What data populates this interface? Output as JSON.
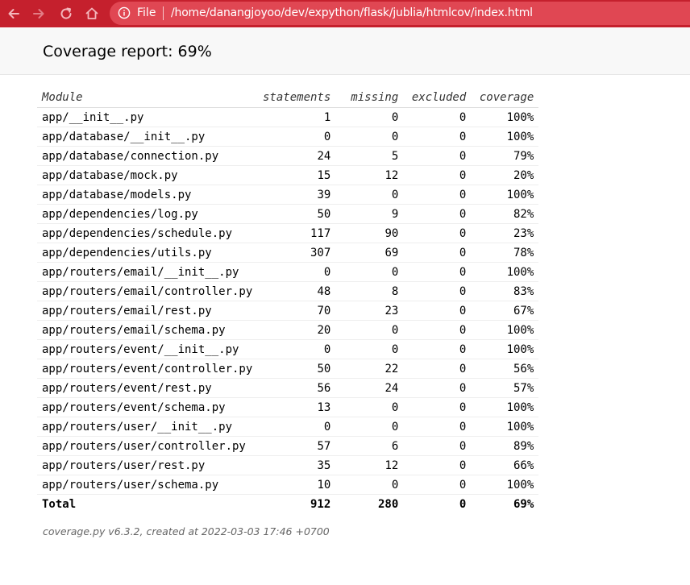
{
  "browser": {
    "scheme_label": "File",
    "url": "/home/danangjoyoo/dev/expython/flask/jublia/htmlcov/index.html",
    "colors": {
      "toolbar": "#c5202d",
      "urlbar": "#e04753"
    },
    "icons": [
      "back-arrow-icon",
      "forward-arrow-icon",
      "reload-icon",
      "home-icon",
      "info-icon"
    ]
  },
  "header": {
    "title": "Coverage report: 69%"
  },
  "table": {
    "columns": {
      "module": "Module",
      "statements": "statements",
      "missing": "missing",
      "excluded": "excluded",
      "coverage": "coverage"
    },
    "rows": [
      {
        "module": "app/__init__.py",
        "statements": "1",
        "missing": "0",
        "excluded": "0",
        "coverage": "100%"
      },
      {
        "module": "app/database/__init__.py",
        "statements": "0",
        "missing": "0",
        "excluded": "0",
        "coverage": "100%"
      },
      {
        "module": "app/database/connection.py",
        "statements": "24",
        "missing": "5",
        "excluded": "0",
        "coverage": "79%"
      },
      {
        "module": "app/database/mock.py",
        "statements": "15",
        "missing": "12",
        "excluded": "0",
        "coverage": "20%"
      },
      {
        "module": "app/database/models.py",
        "statements": "39",
        "missing": "0",
        "excluded": "0",
        "coverage": "100%"
      },
      {
        "module": "app/dependencies/log.py",
        "statements": "50",
        "missing": "9",
        "excluded": "0",
        "coverage": "82%"
      },
      {
        "module": "app/dependencies/schedule.py",
        "statements": "117",
        "missing": "90",
        "excluded": "0",
        "coverage": "23%"
      },
      {
        "module": "app/dependencies/utils.py",
        "statements": "307",
        "missing": "69",
        "excluded": "0",
        "coverage": "78%"
      },
      {
        "module": "app/routers/email/__init__.py",
        "statements": "0",
        "missing": "0",
        "excluded": "0",
        "coverage": "100%"
      },
      {
        "module": "app/routers/email/controller.py",
        "statements": "48",
        "missing": "8",
        "excluded": "0",
        "coverage": "83%"
      },
      {
        "module": "app/routers/email/rest.py",
        "statements": "70",
        "missing": "23",
        "excluded": "0",
        "coverage": "67%"
      },
      {
        "module": "app/routers/email/schema.py",
        "statements": "20",
        "missing": "0",
        "excluded": "0",
        "coverage": "100%"
      },
      {
        "module": "app/routers/event/__init__.py",
        "statements": "0",
        "missing": "0",
        "excluded": "0",
        "coverage": "100%"
      },
      {
        "module": "app/routers/event/controller.py",
        "statements": "50",
        "missing": "22",
        "excluded": "0",
        "coverage": "56%"
      },
      {
        "module": "app/routers/event/rest.py",
        "statements": "56",
        "missing": "24",
        "excluded": "0",
        "coverage": "57%"
      },
      {
        "module": "app/routers/event/schema.py",
        "statements": "13",
        "missing": "0",
        "excluded": "0",
        "coverage": "100%"
      },
      {
        "module": "app/routers/user/__init__.py",
        "statements": "0",
        "missing": "0",
        "excluded": "0",
        "coverage": "100%"
      },
      {
        "module": "app/routers/user/controller.py",
        "statements": "57",
        "missing": "6",
        "excluded": "0",
        "coverage": "89%"
      },
      {
        "module": "app/routers/user/rest.py",
        "statements": "35",
        "missing": "12",
        "excluded": "0",
        "coverage": "66%"
      },
      {
        "module": "app/routers/user/schema.py",
        "statements": "10",
        "missing": "0",
        "excluded": "0",
        "coverage": "100%"
      }
    ],
    "total": {
      "module": "Total",
      "statements": "912",
      "missing": "280",
      "excluded": "0",
      "coverage": "69%"
    }
  },
  "footer": {
    "text": "coverage.py v6.3.2, created at 2022-03-03 17:46 +0700"
  }
}
